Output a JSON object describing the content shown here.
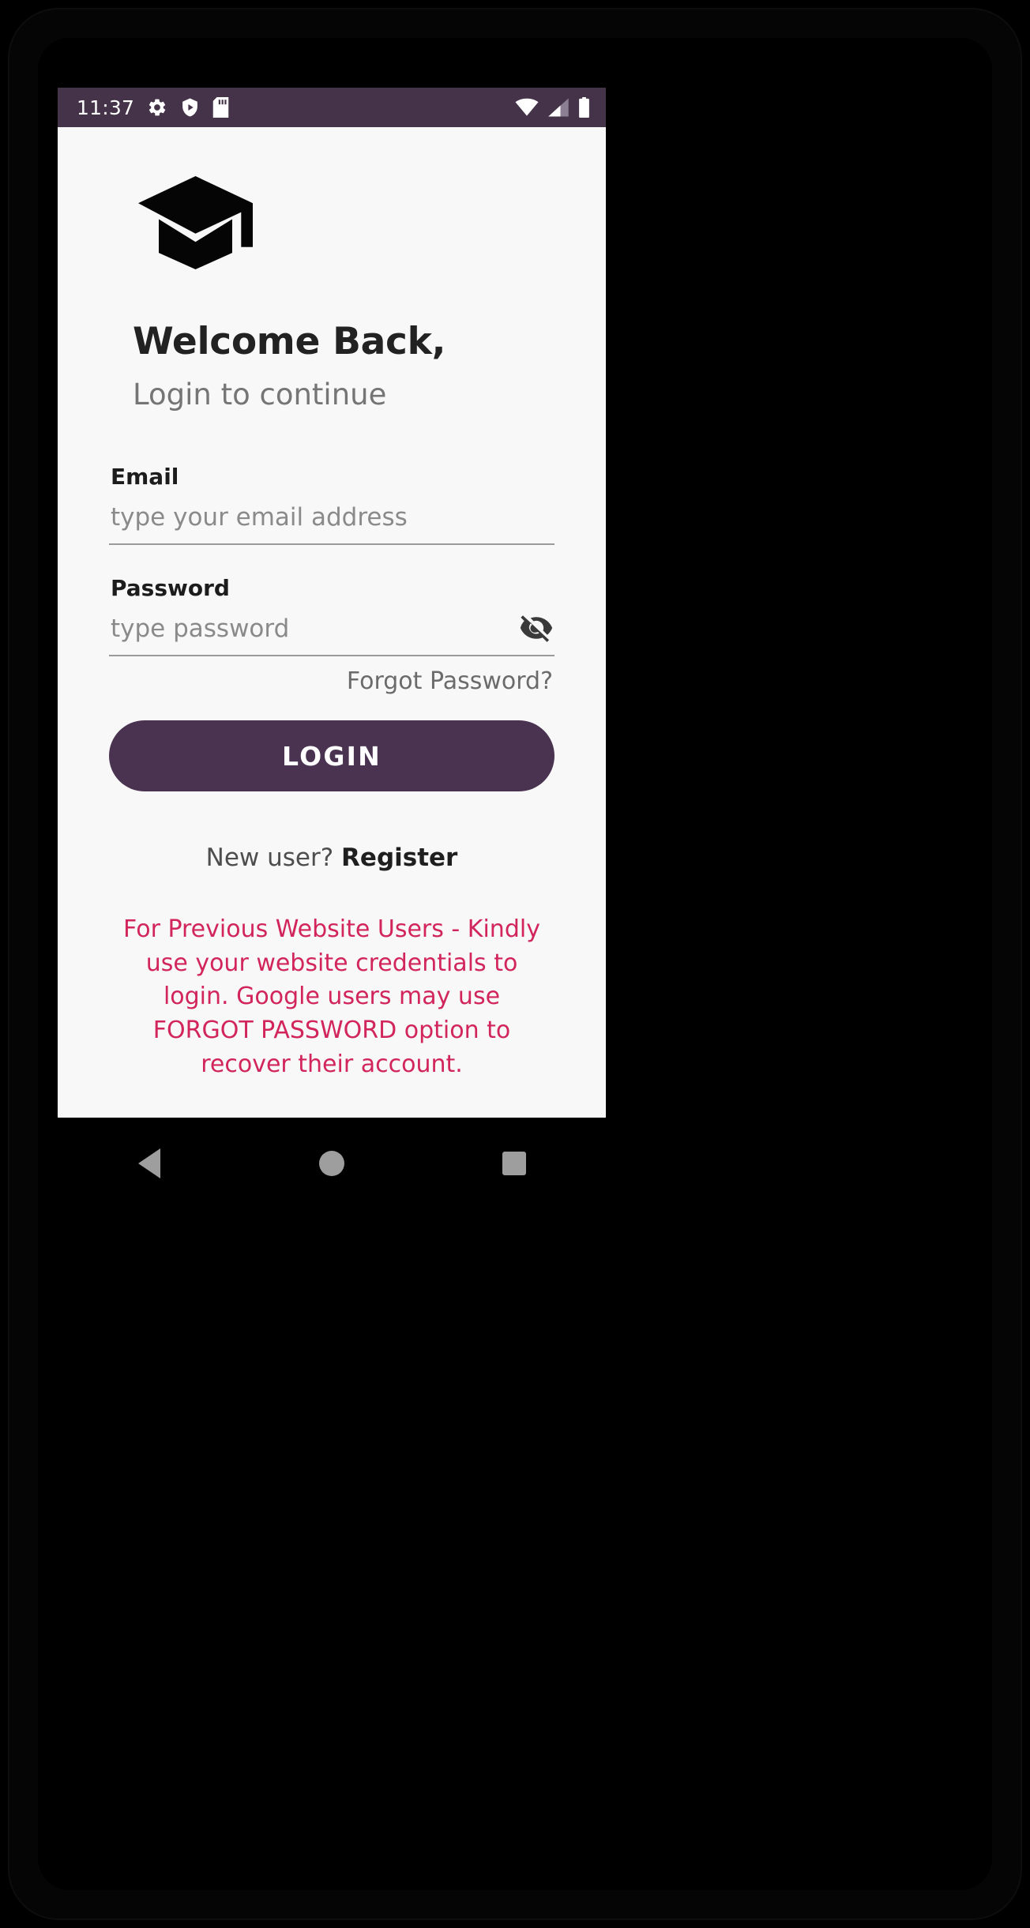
{
  "status_bar": {
    "time": "11:37",
    "left_icons": [
      "gear-icon",
      "shield-play-icon",
      "sd-card-icon"
    ],
    "right_icons": [
      "wifi-icon",
      "cellular-signal-icon",
      "battery-icon"
    ],
    "background_color": "#453349"
  },
  "app": {
    "logo": "graduation-cap-icon",
    "title": "Welcome Back,",
    "subtitle": "Login to continue",
    "background_color": "#f8f8f8"
  },
  "form": {
    "email": {
      "label": "Email",
      "placeholder": "type your email address",
      "value": ""
    },
    "password": {
      "label": "Password",
      "placeholder": "type password",
      "value": "",
      "visibility_icon": "eye-off-icon"
    },
    "forgot_password": "Forgot Password?",
    "login_button": "LOGIN",
    "login_button_color": "#4a3350"
  },
  "footer": {
    "register_prompt": "New user? ",
    "register_link": "Register",
    "notice": "For Previous Website Users - Kindly use your website credentials to login. Google users may use FORGOT PASSWORD option to recover their account.",
    "notice_color": "#d1255c"
  },
  "nav_bar": {
    "back": "back-button",
    "home": "home-button",
    "recents": "recents-button"
  }
}
